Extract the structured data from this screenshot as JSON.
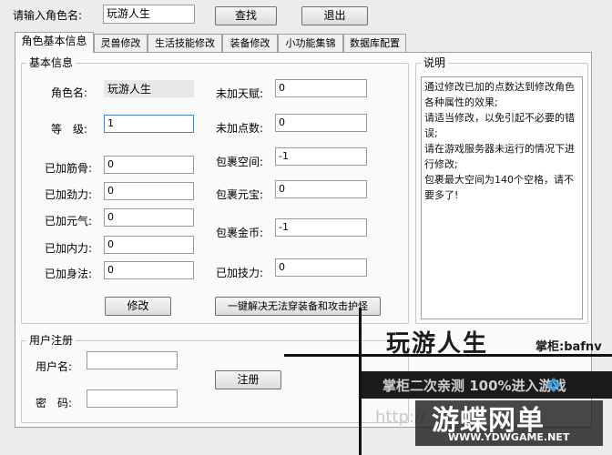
{
  "top": {
    "role_label": "请输入角色名:",
    "role_value": "玩游人生",
    "search_button": "查找",
    "exit_button": "退出"
  },
  "tabs": [
    {
      "label": "角色基本信息",
      "active": true
    },
    {
      "label": "灵兽修改",
      "active": false
    },
    {
      "label": "生活技能修改",
      "active": false
    },
    {
      "label": "装备修改",
      "active": false
    },
    {
      "label": "小功能集锦",
      "active": false
    },
    {
      "label": "数据库配置",
      "active": false
    }
  ],
  "basic_info": {
    "title": "基本信息",
    "role_name_label": "角色名:",
    "role_name_value": "玩游人生",
    "level_label": "等　级:",
    "level_value": "1",
    "left_fields": [
      {
        "label": "已加筋骨:",
        "value": "0"
      },
      {
        "label": "已加劲力:",
        "value": "0"
      },
      {
        "label": "已加元气:",
        "value": "0"
      },
      {
        "label": "已加内力:",
        "value": "0"
      },
      {
        "label": "已加身法:",
        "value": "0"
      }
    ],
    "right_fields": [
      {
        "label": "未加天赋:",
        "value": "0"
      },
      {
        "label": "未加点数:",
        "value": "0"
      },
      {
        "label": "包裹空间:",
        "value": "-1"
      },
      {
        "label": "包裹元宝:",
        "value": "0"
      },
      {
        "label": "包裹金币:",
        "value": "-1"
      },
      {
        "label": "已加技力:",
        "value": "0"
      }
    ],
    "modify_button": "修改",
    "fix_button": "一键解决无法穿装备和攻击护怪"
  },
  "register": {
    "title": "用户注册",
    "username_label": "用户名:",
    "username_value": "",
    "password_label": "密　码:",
    "password_value": "",
    "register_button": "注册"
  },
  "description": {
    "title": "说明",
    "lines": [
      "通过修改已加的点数达到修改角色各种属性的效果;",
      "请适当修改，以免引起不必要的错误;",
      "请在游戏服务器未运行的情况下进行修改;",
      "包裹最大空间为140个空格，请不要多了!"
    ]
  },
  "watermark": {
    "title": "玩游人生",
    "shopkeeper": "掌柜:bafnv",
    "slogan": "掌柜二次亲测 100%进入游戏",
    "url_text": "http://",
    "brand": "游蝶网单",
    "brand_url": "WWW.YDWGAME.NET"
  },
  "colors": {
    "accent_red": "#e81010",
    "watermark_dark": "#1b1b1b"
  }
}
